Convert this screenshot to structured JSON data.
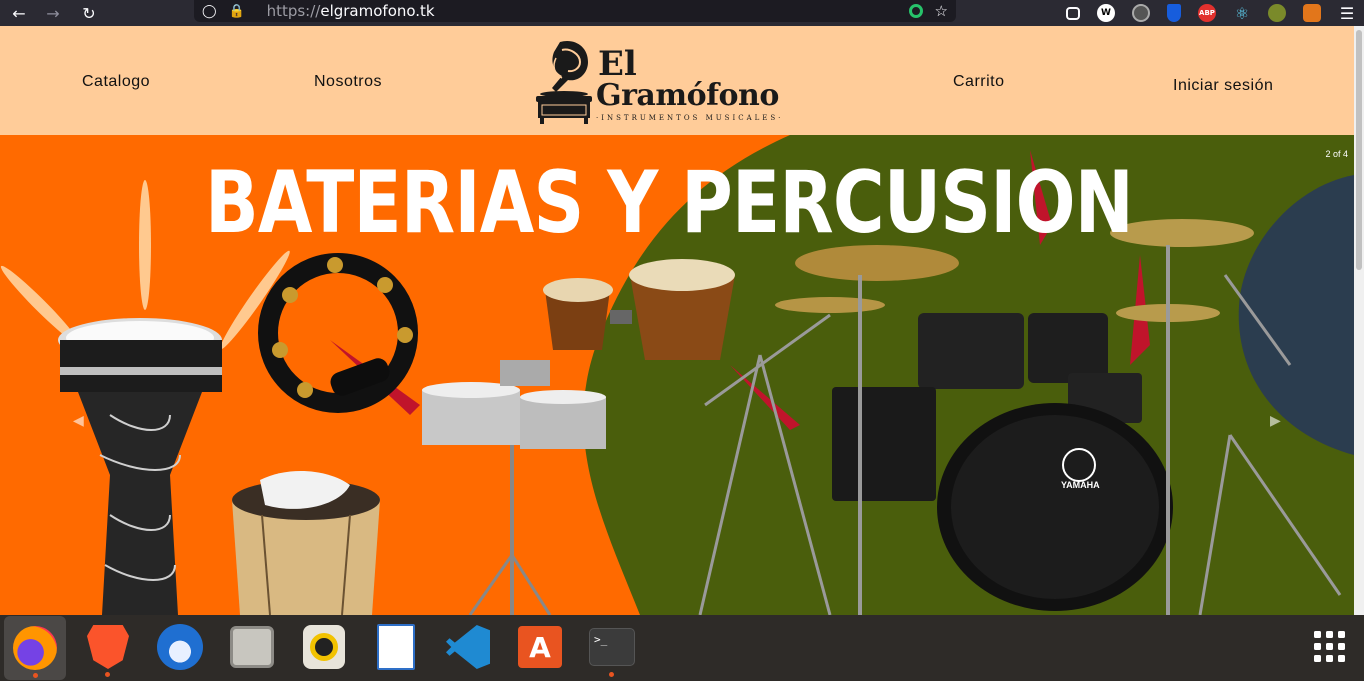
{
  "browser": {
    "url_scheme": "https://",
    "url_host": "elgramofono.tk",
    "extensions": [
      "pocket-icon",
      "w-icon",
      "sync-icon",
      "bitwarden-icon",
      "abp-icon",
      "react-icon",
      "leaf-icon",
      "metamask-icon",
      "menu-icon"
    ],
    "abp_label": "ABP",
    "w_label": "W"
  },
  "site": {
    "nav": {
      "catalog": "Catalogo",
      "about": "Nosotros",
      "cart": "Carrito",
      "login": "Iniciar sesión"
    },
    "logo": {
      "line1": "El",
      "line2": "Gramófono",
      "tagline": "·INSTRUMENTOS MUSICALES·"
    },
    "carousel": {
      "title": "BATERIAS Y PERCUSION",
      "counter": "2 of 4",
      "drum_brand": "YAMAHA"
    }
  },
  "colors": {
    "header_bg": "#ffcc99",
    "slide_orange": "#ff6a00",
    "slide_green": "#4a5e0c",
    "slide_navy": "#2b3d4f",
    "dock_accent": "#e95420"
  },
  "dock": {
    "apps": [
      "firefox-icon",
      "brave-icon",
      "thunderbird-icon",
      "files-icon",
      "rhythmbox-icon",
      "libreoffice-impress-icon",
      "vscode-icon",
      "app-center-icon",
      "terminal-icon"
    ],
    "grid_icon": "show-apps-icon"
  }
}
